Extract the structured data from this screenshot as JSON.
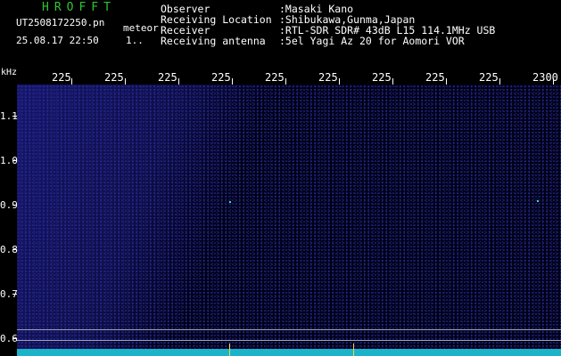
{
  "header": {
    "brand": "HROFFT",
    "filename": "UT2508172250.pn",
    "mode": "meteor",
    "datetime": "25.08.17 22:50",
    "page": "1..",
    "info": [
      {
        "label": "Observer",
        "value": ":Masaki Kano"
      },
      {
        "label": "Receiving Location",
        "value": ":Shibukawa,Gunma,Japan"
      },
      {
        "label": "Receiver",
        "value": ":RTL-SDR SDR# 43dB L15 114.1MHz USB"
      },
      {
        "label": "Receiving antenna",
        "value": ":5el Yagi Az 20 for Aomori VOR"
      }
    ]
  },
  "axis": {
    "unit": "kHz",
    "x_ticks": [
      "225",
      "225",
      "225",
      "225",
      "225",
      "225",
      "225",
      "225",
      "225",
      "2300"
    ],
    "y_ticks": [
      "1.1",
      "1.0",
      "0.9",
      "0.8",
      "0.7",
      "0.6"
    ]
  },
  "colors": {
    "brand": "#2ec62e",
    "background": "#000000",
    "spectrum": "#2a2aa0",
    "baseline": "#1ab3c9",
    "marker": "#ffd23a"
  }
}
